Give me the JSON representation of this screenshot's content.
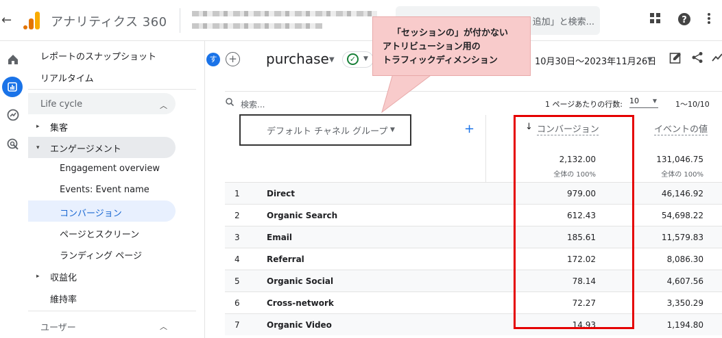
{
  "app": {
    "title": "アナリティクス 360",
    "search_placeholder": "追加」と検索..."
  },
  "sidebar": {
    "top_items": [
      "レポートのスナップショット",
      "リアルタイム"
    ],
    "section": "Life cycle",
    "items": [
      {
        "label": "集客",
        "expandable": true
      },
      {
        "label": "エンゲージメント",
        "expandable": true,
        "expanded": true
      },
      {
        "label": "Engagement overview",
        "sub": true
      },
      {
        "label": "Events: Event name",
        "sub": true
      },
      {
        "label": "コンバージョン",
        "sub": true,
        "active": true
      },
      {
        "label": "ページとスクリーン",
        "sub": true
      },
      {
        "label": "ランディング ページ",
        "sub": true
      },
      {
        "label": "収益化",
        "expandable": true
      },
      {
        "label": "維持率"
      }
    ],
    "next_section": "ユーザー"
  },
  "report": {
    "avatar_letter": "す",
    "title": "purchase",
    "date_range": "10月30日～2023年11月26日"
  },
  "table": {
    "search_placeholder": "検索...",
    "rows_per_page_label": "1 ページあたりの行数:",
    "rows_per_page": "10",
    "pager": "1〜10/10",
    "dimension_header": "デフォルト チャネル グループ",
    "metric_headers": [
      "コンバージョン",
      "イベントの値"
    ],
    "totals": {
      "conversions": "2,132.00",
      "conversions_sub": "全体の 100%",
      "event_value": "131,046.75",
      "event_value_sub": "全体の 100%"
    },
    "rows": [
      {
        "idx": "1",
        "channel": "Direct",
        "conversions": "979.00",
        "event_value": "46,146.92"
      },
      {
        "idx": "2",
        "channel": "Organic Search",
        "conversions": "612.43",
        "event_value": "54,698.22"
      },
      {
        "idx": "3",
        "channel": "Email",
        "conversions": "185.61",
        "event_value": "11,579.83"
      },
      {
        "idx": "4",
        "channel": "Referral",
        "conversions": "172.02",
        "event_value": "8,086.30"
      },
      {
        "idx": "5",
        "channel": "Organic Social",
        "conversions": "78.14",
        "event_value": "4,607.56"
      },
      {
        "idx": "6",
        "channel": "Cross-network",
        "conversions": "72.27",
        "event_value": "3,350.29"
      },
      {
        "idx": "7",
        "channel": "Organic Video",
        "conversions": "14.93",
        "event_value": "1,194.80"
      }
    ]
  },
  "callout": {
    "lines": [
      "「セッションの」が付かない",
      "アトリビューション用の",
      "トラフィックディメンション"
    ],
    "color": "#f8cbcb"
  },
  "highlight_color": "#e50000"
}
